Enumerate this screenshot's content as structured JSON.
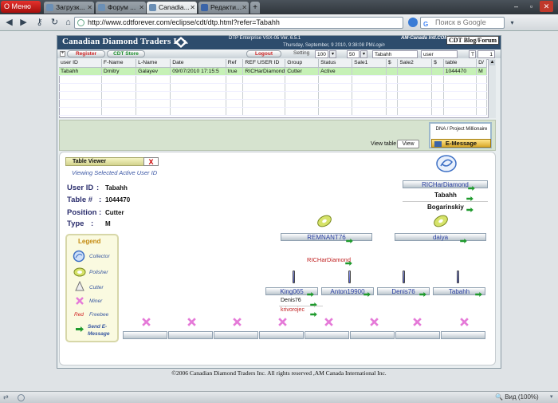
{
  "browser": {
    "menu_label": "Меню",
    "tabs": [
      {
        "title": "Загрузк..."
      },
      {
        "title": "Форум ..."
      },
      {
        "title": "Canadia..."
      },
      {
        "title": "Редакти..."
      }
    ],
    "url": "http://www.cdtforever.com/eclipse/cdt/dtp.html?refer=Tabahh",
    "search_placeholder": "Поиск в Google",
    "zoom_label": "Вид (100%)"
  },
  "header": {
    "brand": "Canadian Diamond Traders Inc.",
    "version": "DTP  Enterprise VSX-05 Ver.  6.5.1",
    "datetime": "Thursday, September, 9  2010,  9:38:08 PM",
    "company": "AM-Canada Intl.COM",
    "blog_button": "CDT Blog/Forum",
    "login_label": "Login",
    "login_user": "Tabahh",
    "login_role": "user",
    "login_tier": "T",
    "login_num": "1",
    "setting_label": "Setting",
    "setting_a": "100",
    "setting_b": "50",
    "logout_button": "Logout",
    "register_button": "Register",
    "store_button": "CDT Store",
    "plus_label": "+"
  },
  "table": {
    "columns": [
      "user ID",
      "F-Name",
      "L-Name",
      "Date",
      "Ref",
      "REF USER ID",
      "Group",
      "Status",
      "Sale1",
      "$",
      "Sale2",
      "$",
      "table",
      "D/"
    ],
    "rows": [
      [
        "Tabahh",
        "Dmitry",
        "Galayev",
        "09/07/2010   17:15:5",
        "true",
        "RICHarDiamond",
        "Cutter",
        "Active",
        "",
        "",
        "",
        "",
        "1044470",
        "M"
      ]
    ]
  },
  "controls": {
    "view_table_label": "View table",
    "view_button": "View",
    "dna_title": "DNA / Project Millionaire",
    "emessage_button": "E-Message"
  },
  "viewer": {
    "title": "Table Viewer",
    "close": "X",
    "subtitle": "Viewing Selected Active User ID",
    "user_id_label": "User ID",
    "user_id": "Tabahh",
    "table_label": "Table #",
    "table_no": "1044470",
    "position_label": "Position",
    "position": "Cutter",
    "type_label": "Type",
    "type": "M"
  },
  "legend": {
    "title": "Legend",
    "items": [
      {
        "icon": "collector-icon",
        "label": "Collector"
      },
      {
        "icon": "polisher-icon",
        "label": "Polisher"
      },
      {
        "icon": "cutter-icon",
        "label": "Cutter"
      },
      {
        "icon": "miner-icon",
        "label": "Miner"
      },
      {
        "icon": "freebee-swatch",
        "label": "Freebee",
        "swatch": "Red"
      },
      {
        "icon": "send-arrow-icon",
        "label": "Send E-Message"
      }
    ]
  },
  "tree": {
    "collector": "RICHarDiamond",
    "collector_sub1": "Tabahh",
    "collector_sub2": "Bogarinskiy",
    "polisher_left": "REMNANT76",
    "polisher_right": "daiya",
    "ref_user": "RICHarDiamond",
    "cutters": [
      "King065",
      "Anton19900",
      "Denis76",
      "Tabahh"
    ],
    "sub1": "Denis76",
    "sub2": "krivorojec"
  },
  "footer": "©2006 Canadian Diamond Traders Inc. All rights reserved ,AM Canada International Inc.",
  "colors": {
    "header_bg": "#2d4c6c",
    "selected_row": "#c6f1b6",
    "arrow_green": "#1f9a2d",
    "miner_pink": "#d84ad0",
    "node_text": "#2a3fa0"
  }
}
